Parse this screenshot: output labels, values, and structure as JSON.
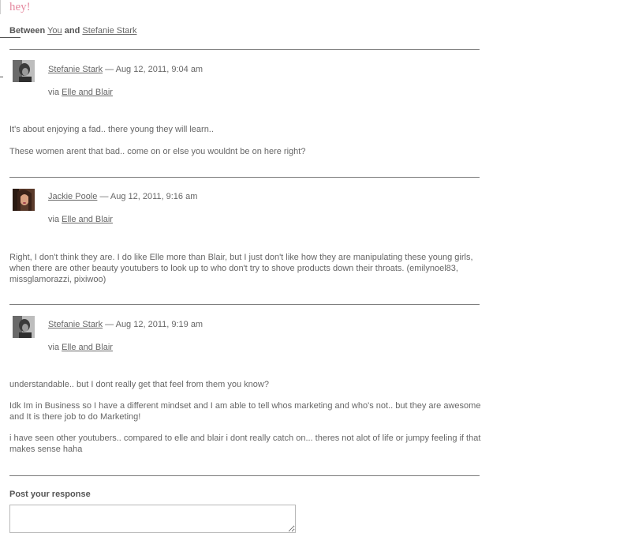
{
  "thread": {
    "title": "hey!",
    "between_label": "Between",
    "participant_you": "You",
    "and_label": "and",
    "participant_other": "Stefanie Stark"
  },
  "messages": [
    {
      "author": "Stefanie Stark",
      "date": "— Aug 12, 2011, 9:04 am",
      "via_label": "via",
      "via_link": "Elle and Blair",
      "paragraphs": [
        "It's about enjoying a fad.. there young they will learn..",
        "These women arent that bad.. come on or else you wouldnt be on here right?"
      ]
    },
    {
      "author": "Jackie Poole",
      "date": "— Aug 12, 2011, 9:16 am",
      "via_label": "via",
      "via_link": "Elle and Blair",
      "paragraphs": [
        "Right, I don't think they are. I do like Elle more than Blair, but I just don't like how they are manipulating these young girls, when there are other beauty youtubers to look up to who don't try to shove products down their throats. (emilynoel83, missglamorazzi, pixiwoo)"
      ]
    },
    {
      "author": "Stefanie Stark",
      "date": "— Aug 12, 2011, 9:19 am",
      "via_label": "via",
      "via_link": "Elle and Blair",
      "paragraphs": [
        "understandable.. but I dont really get that feel from them you know?",
        "Idk Im in Business so I have a different mindset and I am able to tell whos marketing and who's not.. but they are awesome and It is there job to do Marketing!",
        "i have seen other youtubers.. compared to elle and blair i dont really catch on... theres not alot of life or jumpy feeling if that makes sense haha"
      ]
    }
  ],
  "response": {
    "label": "Post your response",
    "value": ""
  }
}
